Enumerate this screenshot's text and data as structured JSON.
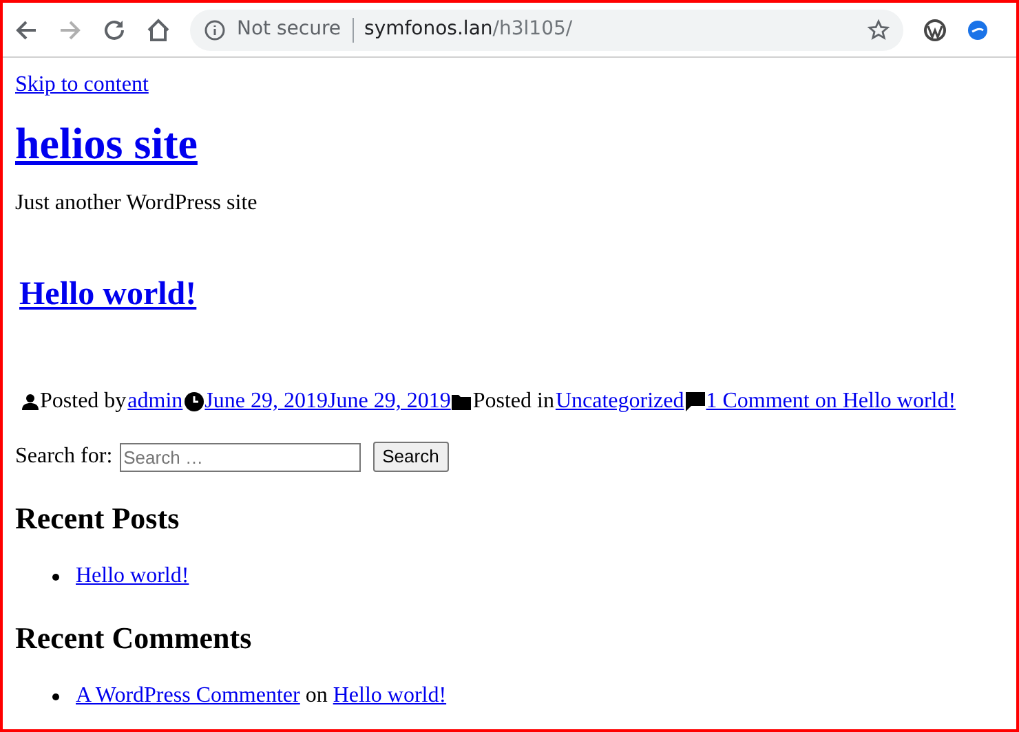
{
  "browser": {
    "back_disabled": false,
    "forward_disabled": true,
    "security": "Not secure",
    "url_host": "symfonos.lan",
    "url_path": "/h3l105/"
  },
  "skip_link": "Skip to content",
  "site_title": "helios site",
  "tagline": "Just another WordPress site",
  "post": {
    "title": "Hello world!",
    "meta": [
      {
        "kind": "author",
        "label": "Posted by",
        "link": "admin"
      },
      {
        "kind": "date",
        "link": "June 29, 2019June 29, 2019"
      },
      {
        "kind": "category",
        "label": "Posted in",
        "link": "Uncategorized"
      },
      {
        "kind": "comments",
        "link": "1 Comment on Hello world!"
      }
    ]
  },
  "search": {
    "label": "Search for:",
    "placeholder": "Search …",
    "button": "Search"
  },
  "recent_posts": {
    "title": "Recent Posts",
    "items": [
      "Hello world!"
    ]
  },
  "recent_comments": {
    "title": "Recent Comments",
    "items": [
      {
        "author": "A WordPress Commenter",
        "joiner": "on",
        "post": "Hello world!"
      }
    ]
  }
}
